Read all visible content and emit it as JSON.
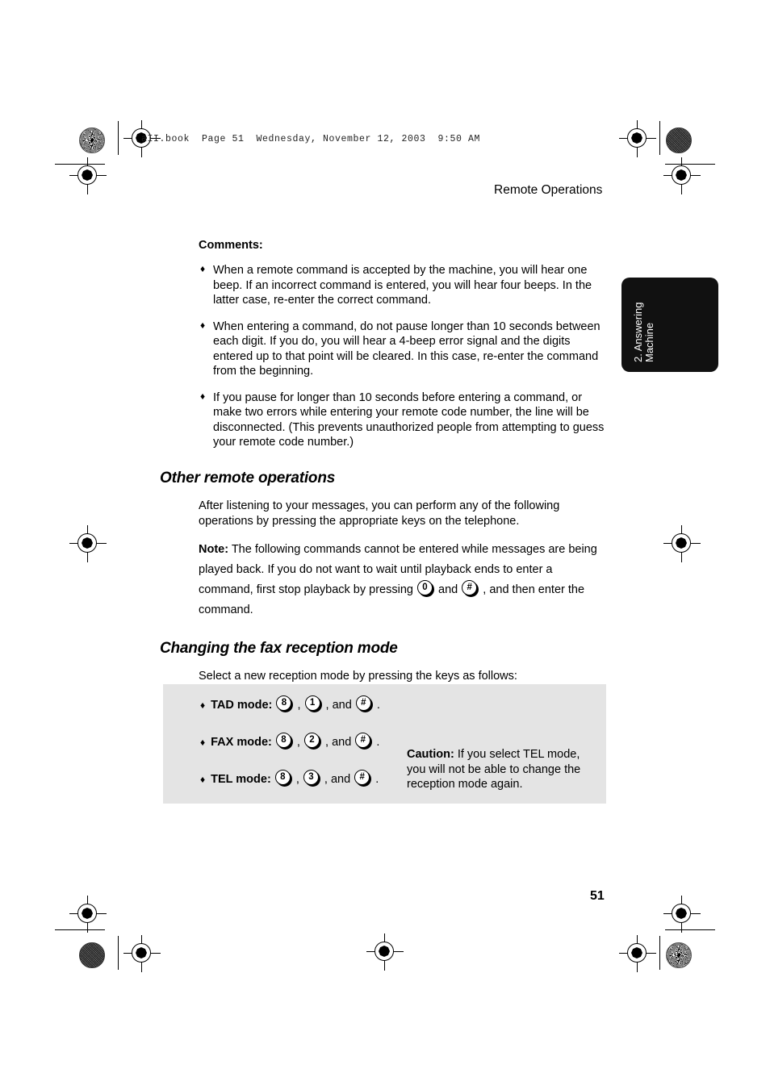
{
  "print_marks": {
    "header_line": "aII.book  Page 51  Wednesday, November 12, 2003  9:50 AM"
  },
  "running_head": {
    "title": "Remote Operations"
  },
  "side_tab": {
    "line1": "2. Answering",
    "line2": "Machine"
  },
  "content": {
    "comments_label": "Comments:",
    "bullet_glyph": "♦",
    "comments": [
      "When a remote command is accepted by the machine, you will hear one beep. If an incorrect command is entered, you will hear four beeps. In the latter case, re-enter the correct command.",
      "When entering a command, do not pause longer than 10 seconds between each digit. If you do, you will hear a 4-beep error signal and the digits entered up to that point will be cleared. In this case, re-enter the command from the beginning.",
      "If you pause for longer than 10 seconds before entering a command, or make two errors while entering your remote code number, the line will be disconnected. (This prevents unauthorized people from attempting to guess your remote code number.)"
    ],
    "section_other": {
      "heading": "Other remote operations",
      "intro": "After listening to your messages, you can perform any of the following operations by pressing the appropriate keys on the telephone.",
      "note_label": "Note:",
      "note_part1": " The following commands cannot be entered while messages are being played back. If you do not want to wait until playback ends to enter a command, first stop playback by pressing ",
      "note_key1": "0",
      "note_mid": " and ",
      "note_key2": "#",
      "note_part2": " , and then enter the command."
    },
    "section_fax": {
      "heading": "Changing the fax reception mode",
      "intro": "Select a new reception mode by pressing the keys as follows:"
    }
  },
  "gray_box": {
    "background_color": "#e4e4e4",
    "modes": [
      {
        "name": "TAD mode:",
        "key1": "8",
        "comma1": " , ",
        "key2": "1",
        "conj": " , and ",
        "key3": "#",
        "period": " ."
      },
      {
        "name": "FAX mode:",
        "key1": "8",
        "comma1": " , ",
        "key2": "2",
        "conj": " , and ",
        "key3": "#",
        "period": " ."
      },
      {
        "name": "TEL mode:",
        "key1": "8",
        "comma1": " , ",
        "key2": "3",
        "conj": " , and ",
        "key3": "#",
        "period": " ."
      }
    ],
    "caution_label": "Caution:",
    "caution_text": " If you select TEL mode, you will not be able to change the reception mode again."
  },
  "footer": {
    "page_number": "51"
  }
}
